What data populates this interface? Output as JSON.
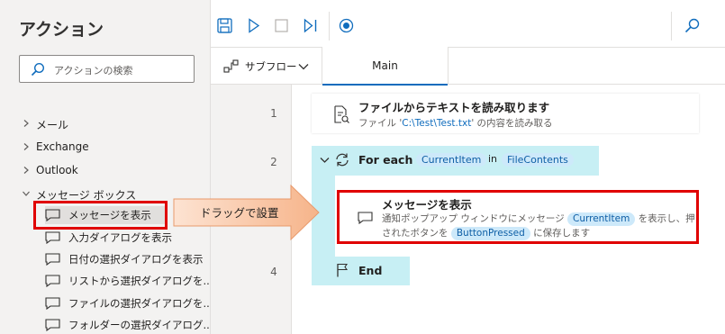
{
  "sidebar": {
    "title": "アクション",
    "search_placeholder": "アクションの検索",
    "groups": [
      {
        "label": "メール"
      },
      {
        "label": "Exchange"
      },
      {
        "label": "Outlook"
      },
      {
        "label": "メッセージ ボックス"
      }
    ],
    "items": [
      {
        "label": "メッセージを表示"
      },
      {
        "label": "入力ダイアログを表示"
      },
      {
        "label": "日付の選択ダイアログを表示"
      },
      {
        "label": "リストから選択ダイアログを..."
      },
      {
        "label": "ファイルの選択ダイアログを..."
      },
      {
        "label": "フォルダーの選択ダイアログ..."
      }
    ]
  },
  "tabs": {
    "subflow_label": "サブフロー",
    "main_label": "Main"
  },
  "annotation": {
    "arrow_label": "ドラッグで設置"
  },
  "flow": {
    "line_numbers": [
      "1",
      "2",
      "4"
    ],
    "step1": {
      "title": "ファイルからテキストを読み取ります",
      "desc_prefix": "ファイル '",
      "desc_path": "C:\\Test\\Test.txt",
      "desc_suffix": "' の内容を読み取る"
    },
    "foreach": {
      "keyword": "For each",
      "var": "CurrentItem",
      "in_word": "in",
      "collection": "FileContents"
    },
    "step3": {
      "title": "メッセージを表示",
      "desc_a": "通知ポップアップ ウィンドウにメッセージ",
      "var1": "CurrentItem",
      "desc_b": "を表示し、押",
      "desc_c": "されたボタンを",
      "var2": "ButtonPressed",
      "desc_d": "に保存します"
    },
    "end_label": "End"
  },
  "colors": {
    "accent": "#0f6cbd",
    "loop_bg": "#c7eff4",
    "highlight_red": "#e00000",
    "arrow_fill": "#f8c9a8"
  }
}
